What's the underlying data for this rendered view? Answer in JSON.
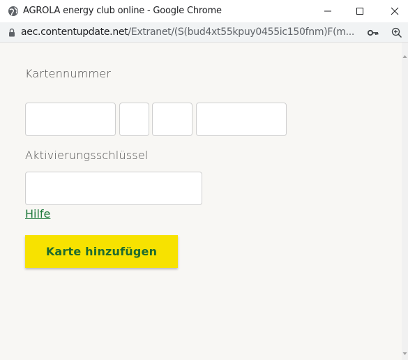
{
  "window": {
    "title": "AGROLA energy club online - Google Chrome",
    "globe_icon": "globe-icon",
    "controls": [
      "minimize-icon",
      "maximize-icon",
      "close-icon"
    ]
  },
  "addressbar": {
    "domain": "aec.contentupdate.net",
    "path": "/Extranet/(S(bud4xt55kpuy0455ic150fnm)F(m...",
    "lock_icon": "lock-icon",
    "key_icon": "key-icon",
    "zoom_icon": "zoom-icon"
  },
  "form": {
    "card_number_label": "Kartennummer",
    "activation_key_label": "Aktivierungsschlüssel",
    "help_link": "Hilfe",
    "submit_button": "Karte hinzufügen",
    "card_fields": [
      "",
      "",
      "",
      ""
    ],
    "activation_key_value": ""
  },
  "colors": {
    "button_bg": "#f7e200",
    "button_text": "#1e6b2e",
    "link": "#1e7a3c",
    "page_bg": "#f8f7f4"
  }
}
